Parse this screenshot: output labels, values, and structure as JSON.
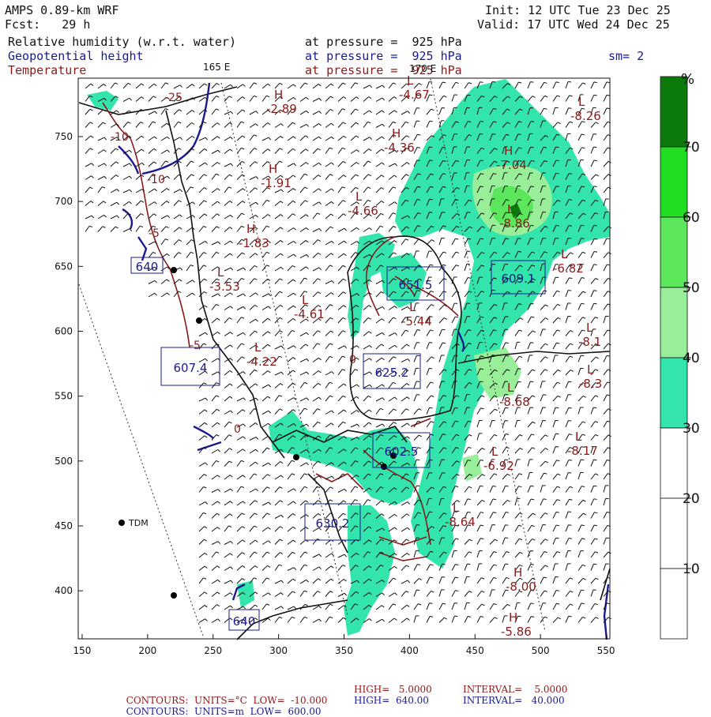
{
  "header": {
    "model": "AMPS 0.89-km WRF",
    "init": "Init: 12 UTC Tue 23 Dec 25",
    "fcst": "Fcst:   29 h",
    "valid": "Valid: 17 UTC Wed 24 Dec 25",
    "fields": [
      {
        "name": "Relative humidity (w.r.t. water)",
        "level": "at pressure =  925 hPa",
        "color": "#111111"
      },
      {
        "name": "Geopotential height",
        "level": "at pressure =  925 hPa",
        "color": "#1a1a8c"
      },
      {
        "name": "Temperature",
        "level": "at pressure =  925 hPa",
        "color": "#8b1a1a"
      }
    ],
    "smoothing": "sm= 2"
  },
  "map_labels": {
    "lon_165e": "165 E",
    "lon_170e": "170 E",
    "station_tdm": "TDM"
  },
  "axes": {
    "x_ticks": [
      "150",
      "200",
      "250",
      "300",
      "350",
      "400",
      "450",
      "500",
      "550"
    ],
    "y_ticks": [
      "750",
      "700",
      "650",
      "600",
      "550",
      "500",
      "450",
      "400"
    ]
  },
  "colorbar": {
    "unit": "%",
    "ticks": [
      "70",
      "60",
      "50",
      "40",
      "30",
      "20",
      "10"
    ],
    "colors": [
      "#0b7a0b",
      "#22dd22",
      "#5ce65c",
      "#99ee99",
      "#33e5ad",
      "#ffffff",
      "#ffffff",
      "#ffffff"
    ]
  },
  "height_boxes": [
    "640",
    "651.5",
    "609.1",
    "607.4",
    "625.2",
    "602.5",
    "630.2",
    "640"
  ],
  "temp_labels": [
    {
      "kind": "L",
      "value": "-4.67"
    },
    {
      "kind": "H",
      "value": "-2.89"
    },
    {
      "kind": "L",
      "value": "-8.26"
    },
    {
      "kind": "H",
      "value": "-4.36"
    },
    {
      "kind": "H",
      "value": "-7.04"
    },
    {
      "kind": "H",
      "value": "-1.91"
    },
    {
      "kind": "L",
      "value": "-4.66"
    },
    {
      "kind": "L",
      "value": "-8.86"
    },
    {
      "kind": "H",
      "value": "-1.83"
    },
    {
      "kind": "L",
      "value": "-6.82"
    },
    {
      "kind": "L",
      "value": "-3.53"
    },
    {
      "kind": "L",
      "value": "-5.44"
    },
    {
      "kind": "L",
      "value": "-4.61"
    },
    {
      "kind": "L",
      "value": "-8.1"
    },
    {
      "kind": "L",
      "value": "-4.22"
    },
    {
      "kind": "L",
      "value": "-8.3"
    },
    {
      "kind": "L",
      "value": "-8.68"
    },
    {
      "kind": "L",
      "value": "-8.17"
    },
    {
      "kind": "L",
      "value": "-6.92"
    },
    {
      "kind": "L",
      "value": "-8.64"
    },
    {
      "kind": "H",
      "value": "-8.00"
    },
    {
      "kind": "H",
      "value": "-5.86"
    }
  ],
  "contour_labels": [
    "-25",
    "-10",
    "-10",
    "-5",
    "-5",
    "0",
    "0"
  ],
  "footer": {
    "line1": {
      "label": "CONTOURS:  UNITS=°C  LOW=  -10.000",
      "high": "HIGH=   5.0000",
      "interval": "INTERVAL=    5.0000",
      "color": "#8b1a1a"
    },
    "line2": {
      "label": "CONTOURS:  UNITS=m  LOW=  600.00",
      "high": "HIGH=  640.00",
      "interval": "INTERVAL=   40.000",
      "color": "#1a1a8c"
    }
  }
}
